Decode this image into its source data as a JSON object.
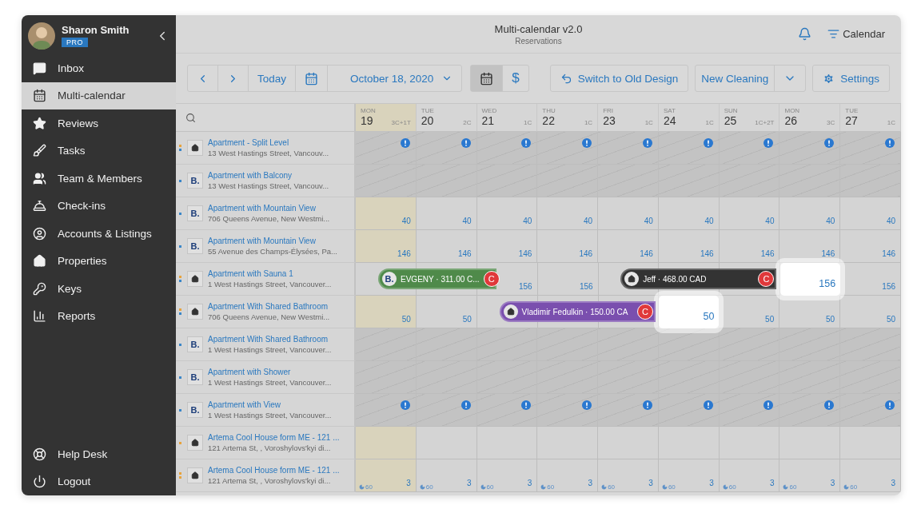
{
  "user": {
    "name": "Sharon Smith",
    "badge": "PRO"
  },
  "sidebar": {
    "items": [
      {
        "label": "Inbox",
        "selected": false
      },
      {
        "label": "Multi-calendar",
        "selected": true
      },
      {
        "label": "Reviews",
        "selected": false
      },
      {
        "label": "Tasks",
        "selected": false
      },
      {
        "label": "Team & Members",
        "selected": false
      },
      {
        "label": "Check-ins",
        "selected": false
      },
      {
        "label": "Accounts & Listings",
        "selected": false
      },
      {
        "label": "Properties",
        "selected": false
      },
      {
        "label": "Keys",
        "selected": false
      },
      {
        "label": "Reports",
        "selected": false
      }
    ],
    "bottom_items": [
      {
        "label": "Help Desk"
      },
      {
        "label": "Logout"
      }
    ]
  },
  "header": {
    "title": "Multi-calendar v2.0",
    "subtitle": "Reservations",
    "calendar_link": "Calendar"
  },
  "toolbar": {
    "today": "Today",
    "date": "October 18, 2020",
    "views": [
      {
        "kind": "calendar",
        "selected": true
      },
      {
        "kind": "text",
        "label": "$",
        "selected": false
      }
    ],
    "switch": "Switch to Old Design",
    "new_cleaning": "New Cleaning",
    "settings": "Settings"
  },
  "days": [
    {
      "dow": "MON",
      "day": "19",
      "count": "3C+1T",
      "today": true
    },
    {
      "dow": "TUE",
      "day": "20",
      "count": "2C",
      "today": false
    },
    {
      "dow": "WED",
      "day": "21",
      "count": "1C",
      "today": false
    },
    {
      "dow": "THU",
      "day": "22",
      "count": "1C",
      "today": false
    },
    {
      "dow": "FRI",
      "day": "23",
      "count": "1C",
      "today": false
    },
    {
      "dow": "SAT",
      "day": "24",
      "count": "1C",
      "today": false
    },
    {
      "dow": "SUN",
      "day": "25",
      "count": "1C+2T",
      "today": false
    },
    {
      "dow": "MON",
      "day": "26",
      "count": "3C",
      "today": false
    },
    {
      "dow": "TUE",
      "day": "27",
      "count": "1C",
      "today": false
    }
  ],
  "listings": [
    {
      "name": "Apartment - Split Level",
      "address": "13 West Hastings Street, Vancouv...",
      "source": {
        "kind": "home"
      },
      "dots": [
        {
          "color": "#e8a33c"
        },
        {
          "color": "#3a86c8"
        }
      ],
      "kind": "alert",
      "blocked": true
    },
    {
      "name": "Apartment with Balcony",
      "address": "13 West Hastings Street, Vancouv...",
      "source": {
        "kind": "booking",
        "label": "B."
      },
      "dots": [
        {
          "color": "#3a86c8"
        }
      ],
      "kind": "empty",
      "blocked": true
    },
    {
      "name": "Apartment with Mountain View",
      "address": "706 Queens Avenue, New Westmi...",
      "source": {
        "kind": "booking",
        "label": "B."
      },
      "dots": [
        {
          "color": "#3a86c8"
        }
      ],
      "kind": "rates",
      "blocked": false,
      "cells": [
        {
          "value": "40"
        },
        {
          "value": "40"
        },
        {
          "value": "40"
        },
        {
          "value": "40"
        },
        {
          "value": "40"
        },
        {
          "value": "40"
        },
        {
          "value": "40"
        },
        {
          "value": "40"
        },
        {
          "value": "40"
        }
      ]
    },
    {
      "name": "Apartment with Mountain View",
      "address": "55 Avenue des Champs-Élysées, Pa...",
      "source": {
        "kind": "booking",
        "label": "B."
      },
      "dots": [
        {
          "color": "#3a86c8"
        }
      ],
      "kind": "rates",
      "blocked": false,
      "cells": [
        {
          "value": "146"
        },
        {
          "value": "146"
        },
        {
          "value": "146"
        },
        {
          "value": "146"
        },
        {
          "value": "146"
        },
        {
          "value": "146"
        },
        {
          "value": "146"
        },
        {
          "value": "146"
        },
        {
          "value": "146"
        }
      ]
    },
    {
      "name": "Apartment with Sauna 1",
      "address": "1 West Hastings Street, Vancouver...",
      "source": {
        "kind": "home"
      },
      "dots": [
        {
          "color": "#e8a33c"
        },
        {
          "color": "#3a86c8"
        }
      ],
      "kind": "rates",
      "blocked": false,
      "cells": [
        {
          "booking": {
            "label": "EVGENY · 311.00 C...",
            "source": {
              "kind": "booking",
              "label": "B."
            },
            "color": "#4f8a4a",
            "badge": "C"
          }
        },
        {
          "booked": true
        },
        {
          "value": "156"
        },
        {
          "value": "156"
        },
        {
          "booking": {
            "label": "Jeff · 468.00 CAD",
            "source": {
              "kind": "home"
            },
            "color": "#333333",
            "badge": "C"
          }
        },
        {
          "booked": true
        },
        {
          "booked": true
        },
        {
          "value": "156",
          "highlight": true
        },
        {
          "value": "156"
        }
      ]
    },
    {
      "name": "Apartment With Shared Bathroom",
      "address": "706 Queens Avenue, New Westmi...",
      "source": {
        "kind": "home"
      },
      "dots": [
        {
          "color": "#e8a33c"
        },
        {
          "color": "#3a86c8"
        }
      ],
      "kind": "rates",
      "blocked": false,
      "cells": [
        {
          "value": "50"
        },
        {
          "value": "50"
        },
        {
          "booking": {
            "label": "Vladimir Fedulkin · 150.00 CA",
            "source": {
              "kind": "home"
            },
            "color": "#7a4fae",
            "badge": "C"
          }
        },
        {
          "booked": true
        },
        {
          "booked": true
        },
        {
          "value": "50",
          "highlight": true
        },
        {
          "value": "50"
        },
        {
          "value": "50"
        },
        {
          "value": "50"
        }
      ]
    },
    {
      "name": "Apartment With Shared Bathroom",
      "address": "1 West Hastings Street, Vancouver...",
      "source": {
        "kind": "booking",
        "label": "B."
      },
      "dots": [
        {
          "color": "#3a86c8"
        }
      ],
      "kind": "empty",
      "blocked": true
    },
    {
      "name": "Apartment with Shower",
      "address": "1 West Hastings Street, Vancouver...",
      "source": {
        "kind": "booking",
        "label": "B."
      },
      "dots": [
        {
          "color": "#3a86c8"
        }
      ],
      "kind": "empty",
      "blocked": true
    },
    {
      "name": "Apartment with View",
      "address": "1 West Hastings Street, Vancouver...",
      "source": {
        "kind": "booking",
        "label": "B."
      },
      "dots": [
        {
          "color": "#3a86c8"
        }
      ],
      "kind": "alert",
      "blocked": true
    },
    {
      "name": "Artema Cool House form ME - 121 ...",
      "address": "121 Artema St, , Voroshylovs'kyi di...",
      "source": {
        "kind": "home"
      },
      "dots": [
        {
          "color": "#e8a33c"
        }
      ],
      "kind": "empty",
      "blocked": false
    },
    {
      "name": "Artema Cool House form ME - 121 ...",
      "address": "121 Artema St, , Voroshylovs'kyi di...",
      "source": {
        "kind": "home"
      },
      "dots": [
        {
          "color": "#e8a33c"
        },
        {
          "color": "#e8a33c"
        }
      ],
      "kind": "rates",
      "blocked": false,
      "cells": [
        {
          "value": "3",
          "min_stay": "60"
        },
        {
          "value": "3",
          "min_stay": "60"
        },
        {
          "value": "3",
          "min_stay": "60"
        },
        {
          "value": "3",
          "min_stay": "60"
        },
        {
          "value": "3",
          "min_stay": "60"
        },
        {
          "value": "3",
          "min_stay": "60"
        },
        {
          "value": "3",
          "min_stay": "60"
        },
        {
          "value": "3",
          "min_stay": "60"
        },
        {
          "value": "3",
          "min_stay": "60"
        }
      ]
    }
  ]
}
